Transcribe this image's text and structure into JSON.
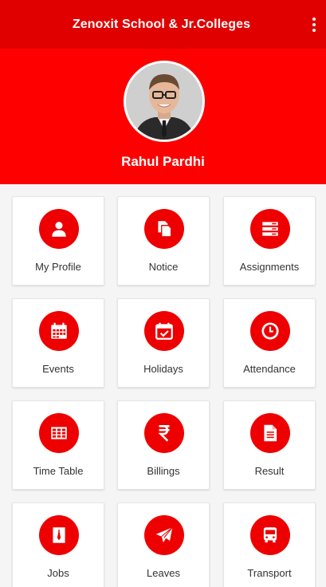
{
  "app": {
    "title": "Zenoxit School & Jr.Colleges"
  },
  "profile": {
    "name": "Rahul Pardhi"
  },
  "colors": {
    "appbar": "#e00000",
    "hero": "#ff0000",
    "accent": "#ee0000"
  },
  "menu": [
    {
      "label": "My Profile",
      "icon": "user-icon"
    },
    {
      "label": "Notice",
      "icon": "notice-icon"
    },
    {
      "label": "Assignments",
      "icon": "assignments-icon"
    },
    {
      "label": "Events",
      "icon": "calendar-icon"
    },
    {
      "label": "Holidays",
      "icon": "calendar-check-icon"
    },
    {
      "label": "Attendance",
      "icon": "clock-icon"
    },
    {
      "label": "Time Table",
      "icon": "table-icon"
    },
    {
      "label": "Billings",
      "icon": "rupee-icon"
    },
    {
      "label": "Result",
      "icon": "document-icon"
    },
    {
      "label": "Jobs",
      "icon": "tie-icon"
    },
    {
      "label": "Leaves",
      "icon": "paper-plane-icon"
    },
    {
      "label": "Transport",
      "icon": "bus-icon"
    }
  ]
}
